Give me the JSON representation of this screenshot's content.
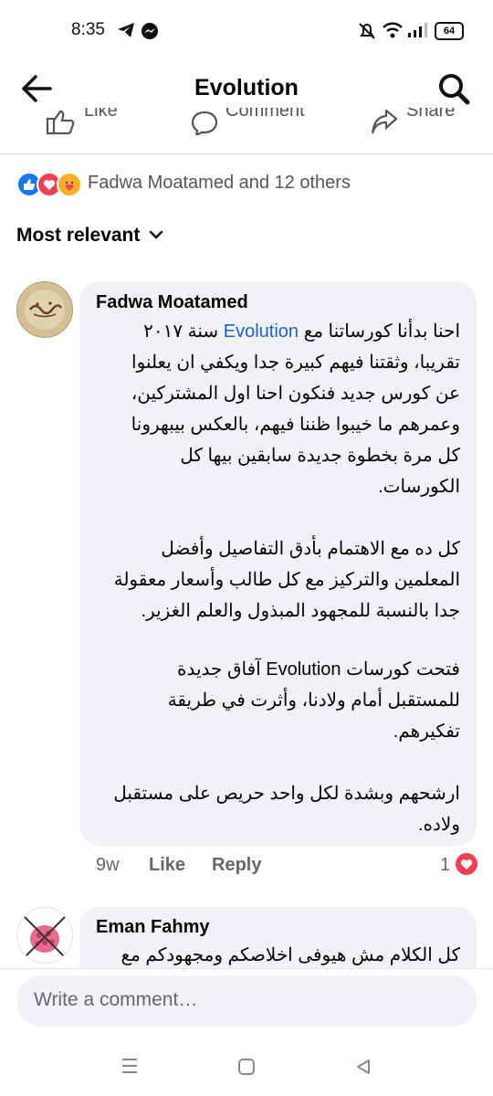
{
  "status_bar": {
    "time": "8:35",
    "battery": "64"
  },
  "header": {
    "title": "Evolution"
  },
  "action_bar": {
    "like": "Like",
    "comment": "Comment",
    "share": "Share"
  },
  "reactions": {
    "summary": "Fadwa Moatamed and 12 others",
    "icons": [
      "like-icon",
      "love-icon",
      "care-icon"
    ],
    "colors": {
      "like": "#1877f2",
      "love": "#f33e58",
      "care": "#f7b125"
    }
  },
  "sort": {
    "label": "Most relevant"
  },
  "comment1": {
    "author": "Fadwa Moatamed",
    "lines": [
      "احنا بدأنا كورساتنا مع",
      "Evolution",
      "سنة ٢٠١٧",
      "تقريبا، وثقتنا فيهم كبيرة جدا ويكفي ان يعلنوا",
      "عن كورس جديد فنكون احنا اول المشتركين،",
      "وعمرهم ما خيبوا ظننا فيهم، بالعكس بيبهرونا",
      "كل مرة بخطوة جديدة سابقين بيها كل",
      "الكورسات.",
      "كل ده مع الاهتمام بأدق التفاصيل وأفضل",
      "المعلمين والتركيز مع كل طالب وأسعار معقولة",
      "جدا بالنسبة للمجهود المبذول والعلم الغزير.",
      "فتحت كورسات Evolution آفاق جديدة",
      "للمستقبل أمام ولادنا، وأثرت في طريقة",
      "تفكيرهم.",
      "ارشحهم وبشدة لكل واحد حريص على مستقبل",
      "ولاده."
    ],
    "time": "9w",
    "like": "Like",
    "reply": "Reply",
    "reaction_count": "1"
  },
  "comment2": {
    "author": "Eman Fahmy",
    "text": "كل الكلام مش هيوفى اخلاصكم ومجهودكم مع"
  },
  "composer": {
    "placeholder": "Write a comment…"
  }
}
